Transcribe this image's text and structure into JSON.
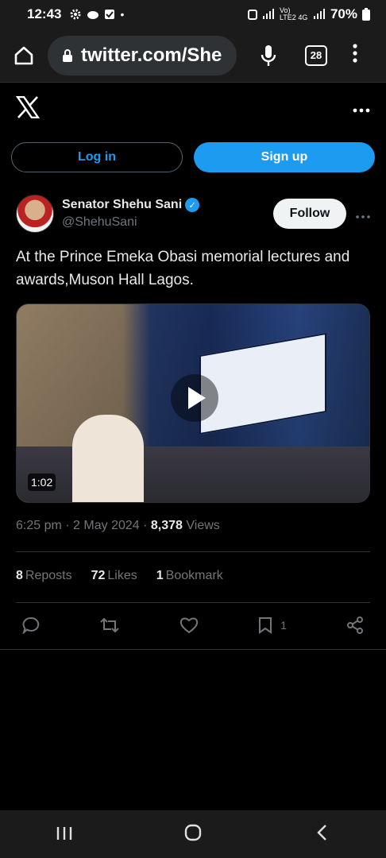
{
  "status_bar": {
    "time": "12:43",
    "network": "Vo) LTE2 4G",
    "battery": "70%"
  },
  "browser": {
    "url": "twitter.com/She",
    "tab_count": "28"
  },
  "auth": {
    "login_label": "Log in",
    "signup_label": "Sign up"
  },
  "tweet": {
    "author_name": "Senator Shehu Sani",
    "author_handle": "@ShehuSani",
    "follow_label": "Follow",
    "text": "At the Prince Emeka Obasi memorial lectures and awards,Muson Hall Lagos.",
    "video_duration": "1:02",
    "time": "6:25 pm",
    "date": "2 May 2024",
    "views_count": "8,378",
    "views_label": "Views",
    "reposts_count": "8",
    "reposts_label": "Reposts",
    "likes_count": "72",
    "likes_label": "Likes",
    "bookmarks_count": "1",
    "bookmarks_label": "Bookmark",
    "bookmark_action_count": "1"
  },
  "colors": {
    "accent": "#1d9bf0",
    "background": "#000000",
    "muted": "#71767b"
  },
  "icons": [
    "home-icon",
    "lock-icon",
    "mic-icon",
    "tabs-icon",
    "menu-icon",
    "x-logo-icon",
    "more-icon",
    "verified-icon",
    "play-icon",
    "reply-icon",
    "repost-icon",
    "like-icon",
    "bookmark-icon",
    "share-icon",
    "recents-icon",
    "home-nav-icon",
    "back-icon"
  ]
}
